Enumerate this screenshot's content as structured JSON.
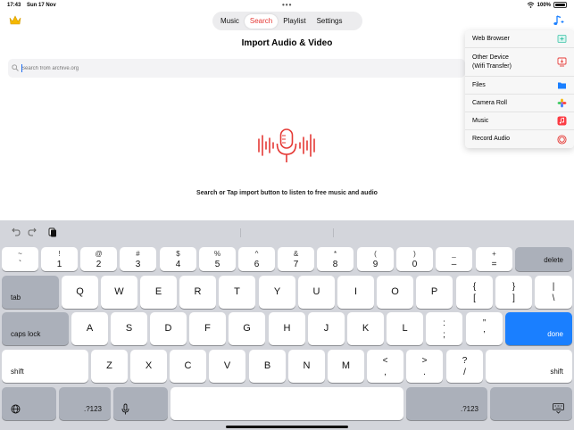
{
  "status_bar": {
    "time": "17:43",
    "date": "Sun 17 Nov",
    "battery": "100%"
  },
  "tabs": [
    {
      "label": "Music",
      "active": false
    },
    {
      "label": "Search",
      "active": true
    },
    {
      "label": "Playlist",
      "active": false
    },
    {
      "label": "Settings",
      "active": false
    }
  ],
  "page_title": "Import Audio & Video",
  "search": {
    "placeholder": "Search from archive.org",
    "value": ""
  },
  "menu": {
    "items": [
      {
        "label": "Web Browser",
        "icon": "web-browser-icon"
      },
      {
        "label": "Other Device (Wifi Transfer)",
        "line1": "Other Device",
        "line2": "(Wifi Transfer)",
        "icon": "wifi-transfer-icon"
      },
      {
        "label": "Files",
        "icon": "files-folder-icon"
      },
      {
        "label": "Camera Roll",
        "icon": "photos-icon"
      },
      {
        "label": "Music",
        "icon": "music-icon"
      },
      {
        "label": "Record Audio",
        "icon": "record-icon"
      }
    ]
  },
  "hint": "Search or Tap import button to listen to free music and audio",
  "keyboard": {
    "row1": [
      {
        "top": "~",
        "bottom": "`"
      },
      {
        "top": "!",
        "bottom": "1"
      },
      {
        "top": "@",
        "bottom": "2"
      },
      {
        "top": "#",
        "bottom": "3"
      },
      {
        "top": "$",
        "bottom": "4"
      },
      {
        "top": "%",
        "bottom": "5"
      },
      {
        "top": "^",
        "bottom": "6"
      },
      {
        "top": "&",
        "bottom": "7"
      },
      {
        "top": "*",
        "bottom": "8"
      },
      {
        "top": "(",
        "bottom": "9"
      },
      {
        "top": ")",
        "bottom": "0"
      },
      {
        "top": "_",
        "bottom": "–"
      },
      {
        "top": "+",
        "bottom": "="
      }
    ],
    "delete": "delete",
    "tab": "tab",
    "row2": [
      "Q",
      "W",
      "E",
      "R",
      "T",
      "Y",
      "U",
      "I",
      "O",
      "P"
    ],
    "row2_punct": [
      {
        "top": "{",
        "bottom": "["
      },
      {
        "top": "}",
        "bottom": "]"
      },
      {
        "top": "|",
        "bottom": "\\"
      }
    ],
    "caps": "caps lock",
    "row3": [
      "A",
      "S",
      "D",
      "F",
      "G",
      "H",
      "J",
      "K",
      "L"
    ],
    "row3_punct": [
      {
        "top": ":",
        "bottom": ";"
      },
      {
        "top": "”",
        "bottom": "’"
      }
    ],
    "done": "done",
    "shift": "shift",
    "row4": [
      "Z",
      "X",
      "C",
      "V",
      "B",
      "N",
      "M"
    ],
    "row4_punct": [
      {
        "top": "<",
        "bottom": ","
      },
      {
        "top": ">",
        "bottom": "."
      },
      {
        "top": "?",
        "bottom": "/"
      }
    ],
    "numeric": ".?123"
  },
  "colors": {
    "accent": "#e53935",
    "key_blue": "#1a7fff",
    "keyboard_bg": "#d3d5db"
  }
}
